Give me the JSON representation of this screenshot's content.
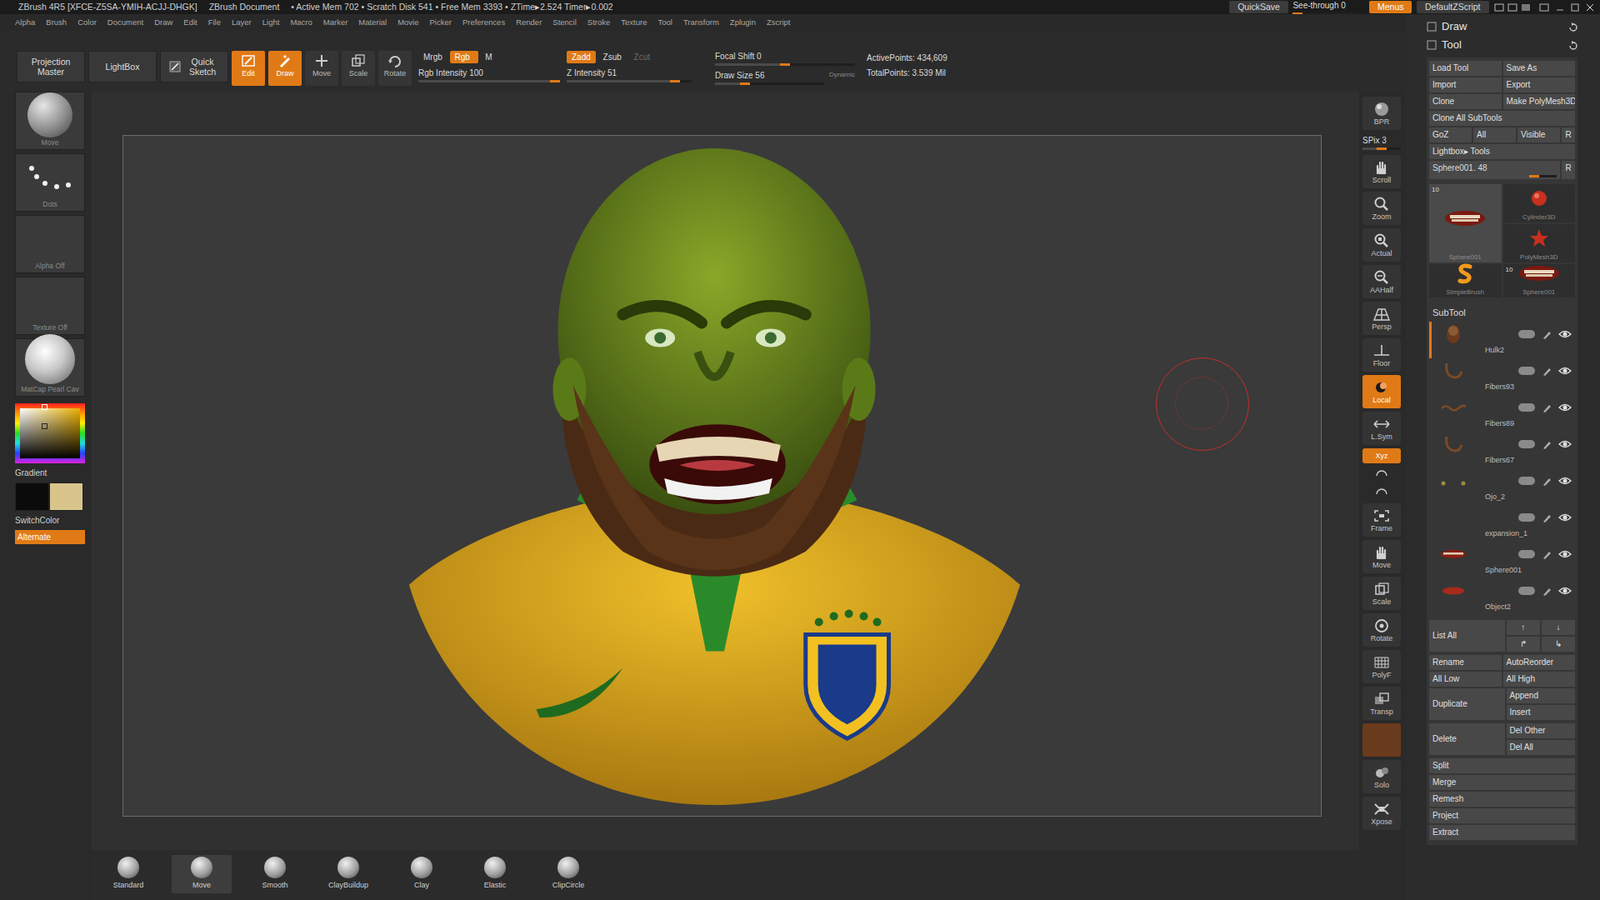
{
  "title_bar": {
    "app": "ZBrush 4R5 [XFCE-Z5SA-YMIH-ACJJ-DHGK]",
    "document": "ZBrush Document",
    "stats": "• Active Mem 702 • Scratch Disk 541 • Free Mem 3393 • ZTime▸2.524 Timer▸0.002",
    "quicksave": "QuickSave",
    "see_through": {
      "label": "See-through",
      "value": "0",
      "level": 0
    },
    "menus": {
      "label": "Menus",
      "on": true
    },
    "script": "DefaultZScript"
  },
  "menu_bar": [
    "Alpha",
    "Brush",
    "Color",
    "Document",
    "Draw",
    "Edit",
    "File",
    "Layer",
    "Light",
    "Macro",
    "Marker",
    "Material",
    "Movie",
    "Picker",
    "Preferences",
    "Render",
    "Stencil",
    "Stroke",
    "Texture",
    "Tool",
    "Transform",
    "Zplugin",
    "Zscript"
  ],
  "toolbar": {
    "panels": [
      {
        "label": "Projection Master",
        "kind": "plain"
      },
      {
        "label": "LightBox",
        "kind": "plain"
      },
      {
        "label": "Quick Sketch",
        "kind": "sketch"
      }
    ],
    "modes": [
      {
        "label": "Edit",
        "kind": "edit",
        "on": true
      },
      {
        "label": "Draw",
        "kind": "draw",
        "on": true
      },
      {
        "label": "Move",
        "kind": "move",
        "on": false
      },
      {
        "label": "Scale",
        "kind": "scale",
        "on": false
      },
      {
        "label": "Rotate",
        "kind": "rotate",
        "on": false
      }
    ],
    "color_modes": [
      {
        "label": "Mrgb",
        "on": false,
        "disabled": false
      },
      {
        "label": "Rgb",
        "on": true,
        "disabled": false
      },
      {
        "label": "M",
        "on": false,
        "disabled": false
      }
    ],
    "rgb_intensity": {
      "label": "Rgb Intensity",
      "value": "100",
      "level": 1
    },
    "depth_modes": [
      {
        "label": "Zadd",
        "on": true,
        "disabled": false
      },
      {
        "label": "Zsub",
        "on": false,
        "disabled": false
      },
      {
        "label": "Zcut",
        "on": false,
        "disabled": true
      }
    ],
    "z_intensity": {
      "label": "Z Intensity",
      "value": "51",
      "level": 0.9
    },
    "focal_shift": {
      "label": "Focal Shift",
      "value": "0",
      "level": 0.5
    },
    "draw_size": {
      "label": "Draw Size",
      "value": "56",
      "level": 0.25
    },
    "dynamic": "Dynamic",
    "active_points": "ActivePoints: 434,609",
    "total_points": "TotalPoints: 3.539 Mil"
  },
  "left_shelf": {
    "slots": [
      {
        "label": "Move",
        "kind": "brush"
      },
      {
        "label": "Dots",
        "kind": "stroke"
      },
      {
        "label": "Alpha Off",
        "kind": "empty"
      },
      {
        "label": "Texture Off",
        "kind": "empty"
      },
      {
        "label": "MatCap Pearl Cav",
        "kind": "material"
      }
    ],
    "gradient": "Gradient",
    "main_color": "#0b0b0b",
    "secondary_color": "#d9c58c",
    "switch_color": "SwitchColor",
    "alternate": {
      "label": "Alternate",
      "on": true
    }
  },
  "right_shelf": [
    {
      "label": "BPR",
      "kind": "bpr",
      "on": false
    },
    {
      "label": "SPix 3",
      "kind": "slider",
      "on": false,
      "level": 0.5
    },
    {
      "label": "Scroll",
      "kind": "scroll",
      "on": false
    },
    {
      "label": "Zoom",
      "kind": "zoom",
      "on": false
    },
    {
      "label": "Actual",
      "kind": "actual",
      "on": false
    },
    {
      "label": "AAHalf",
      "kind": "aahalf",
      "on": false
    },
    {
      "label": "Persp",
      "kind": "persp",
      "on": false
    },
    {
      "label": "Floor",
      "kind": "floor",
      "on": false
    },
    {
      "label": "Local",
      "kind": "local",
      "on": true
    },
    {
      "label": "L.Sym",
      "kind": "lsym",
      "on": false
    },
    {
      "label": "Xyz",
      "kind": "xyz",
      "on": true
    },
    {
      "kind": "rot",
      "on": false
    },
    {
      "kind": "rot",
      "on": false
    },
    {
      "label": "Frame",
      "kind": "frame",
      "on": false
    },
    {
      "label": "Move",
      "kind": "move",
      "on": false
    },
    {
      "label": "Scale",
      "kind": "scale",
      "on": false
    },
    {
      "label": "Rotate",
      "kind": "rotate",
      "on": false
    },
    {
      "label": "PolyF",
      "kind": "polyf",
      "on": false
    },
    {
      "label": "Transp",
      "kind": "transp",
      "on": false
    },
    {
      "kind": "blank",
      "on": false
    },
    {
      "label": "Solo",
      "kind": "solo",
      "on": false
    },
    {
      "label": "Xpose",
      "kind": "xpose",
      "on": false
    }
  ],
  "right_panel": {
    "palettes": [
      "Draw",
      "Tool"
    ],
    "tool_rows": [
      [
        {
          "label": "Load Tool",
          "kind": "button"
        },
        {
          "label": "Save As",
          "kind": "button"
        }
      ],
      [
        {
          "label": "Import",
          "kind": "button"
        },
        {
          "label": "Export",
          "kind": "button"
        }
      ],
      [
        {
          "label": "Clone",
          "kind": "button"
        },
        {
          "label": "Make PolyMesh3D",
          "kind": "button"
        }
      ],
      [
        {
          "label": "Clone  All SubTools",
          "kind": "button"
        }
      ],
      [
        {
          "label": "GoZ",
          "kind": "button"
        },
        {
          "label": "All",
          "kind": "button"
        },
        {
          "label": "Visible",
          "kind": "button"
        },
        {
          "label": "R",
          "kind": "small"
        }
      ],
      [
        {
          "label": "Lightbox▸ Tools",
          "kind": "button"
        }
      ],
      [
        {
          "label": "Sphere001. 48",
          "kind": "slider",
          "level": 0.85
        },
        {
          "label": "R",
          "kind": "small"
        }
      ]
    ],
    "tools": [
      {
        "name": "Sphere001",
        "kind": "mouth",
        "badge": "10",
        "selected": true
      },
      {
        "name": "Cylinder3D",
        "kind": "cylinder",
        "selected": false
      },
      {
        "name": "PolyMesh3D",
        "kind": "star",
        "selected": false
      },
      {
        "name": "SimpleBrush",
        "kind": "brush",
        "selected": false
      },
      {
        "name": "Sphere001",
        "kind": "mouth",
        "badge": "10",
        "selected": false
      }
    ],
    "subtool_title": "SubTool",
    "subtools": [
      {
        "name": "Hulk2",
        "kind": "head",
        "selected": true,
        "visible": true
      },
      {
        "name": "Fibers93",
        "kind": "arc",
        "selected": false,
        "visible": true
      },
      {
        "name": "Fibers89",
        "kind": "hair",
        "selected": false,
        "visible": true
      },
      {
        "name": "Fibers67",
        "kind": "arc",
        "selected": false,
        "visible": true
      },
      {
        "name": "Ojo_2",
        "kind": "eyes",
        "selected": false,
        "visible": true
      },
      {
        "name": "expansion_1",
        "kind": "none",
        "selected": false,
        "visible": true
      },
      {
        "name": "Sphere001",
        "kind": "mouth",
        "selected": false,
        "visible": true
      },
      {
        "name": "Object2",
        "kind": "lips",
        "selected": false,
        "visible": true
      }
    ],
    "actions": [
      {
        "kind": "split",
        "left": "List All",
        "right": [
          "↑",
          "↓",
          "↱",
          "↳"
        ]
      },
      {
        "kind": "pair",
        "items": [
          "Rename",
          "AutoReorder"
        ]
      },
      {
        "kind": "pair",
        "items": [
          "All Low",
          "All High"
        ]
      },
      {
        "kind": "split",
        "left": "Duplicate",
        "right": [
          "Append",
          "Insert"
        ]
      },
      {
        "kind": "split",
        "left": "Delete",
        "right": [
          "Del Other",
          "Del All"
        ]
      },
      {
        "kind": "single",
        "items": [
          "Split"
        ]
      },
      {
        "kind": "single",
        "items": [
          "Merge"
        ]
      },
      {
        "kind": "single",
        "items": [
          "Remesh"
        ]
      },
      {
        "kind": "single",
        "items": [
          "Project"
        ]
      },
      {
        "kind": "single",
        "items": [
          "Extract"
        ]
      }
    ]
  },
  "brush_shelf": [
    {
      "label": "Standard",
      "selected": false
    },
    {
      "label": "Move",
      "selected": true
    },
    {
      "label": "Smooth",
      "selected": false
    },
    {
      "label": "ClayBuildup",
      "selected": false
    },
    {
      "label": "Clay",
      "selected": false
    },
    {
      "label": "Elastic",
      "selected": false
    },
    {
      "label": "ClipCircle",
      "selected": false
    }
  ]
}
